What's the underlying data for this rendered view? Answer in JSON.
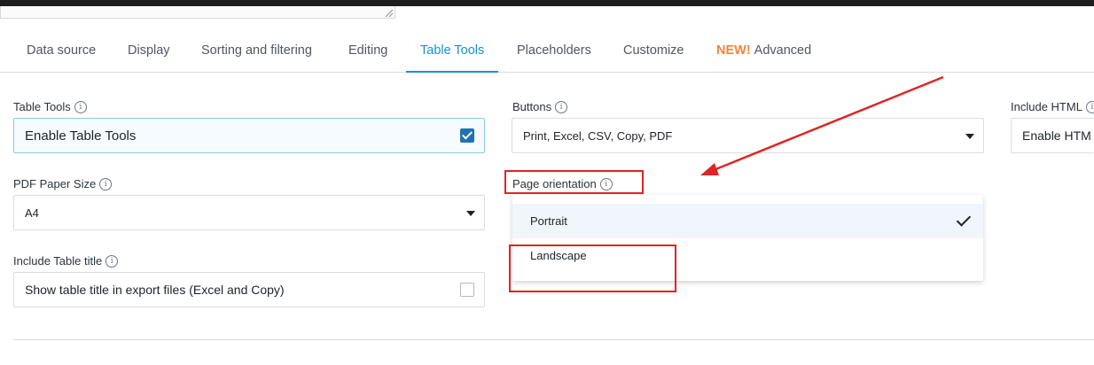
{
  "tabs": [
    {
      "label": "Data source"
    },
    {
      "label": "Display"
    },
    {
      "label": "Sorting and filtering"
    },
    {
      "label": "Editing"
    },
    {
      "label": "Table Tools",
      "active": true
    },
    {
      "label": "Placeholders"
    },
    {
      "label": "Customize"
    },
    {
      "label": "Advanced",
      "badge": "NEW!"
    }
  ],
  "fields": {
    "table_tools": {
      "label": "Table Tools",
      "value": "Enable Table Tools",
      "checked": true
    },
    "buttons": {
      "label": "Buttons",
      "value": "Print, Excel, CSV, Copy, PDF"
    },
    "include_html": {
      "label": "Include HTML",
      "value": "Enable HTM"
    },
    "pdf_paper_size": {
      "label": "PDF Paper Size",
      "value": "A4"
    },
    "page_orientation": {
      "label": "Page orientation",
      "options": [
        {
          "label": "Portrait",
          "selected": true
        },
        {
          "label": "Landscape",
          "selected": false
        }
      ]
    },
    "include_table_title": {
      "label": "Include Table title",
      "value": "Show table title in export files (Excel and Copy)",
      "checked": false
    }
  },
  "icons": {
    "info": "info-icon",
    "caret": "caret-down-icon",
    "check": "checkmark-icon"
  },
  "colors": {
    "accent": "#1a8fd0",
    "new_badge": "#f0863c",
    "annotation": "#e02424",
    "checkbox": "#2271b1"
  }
}
